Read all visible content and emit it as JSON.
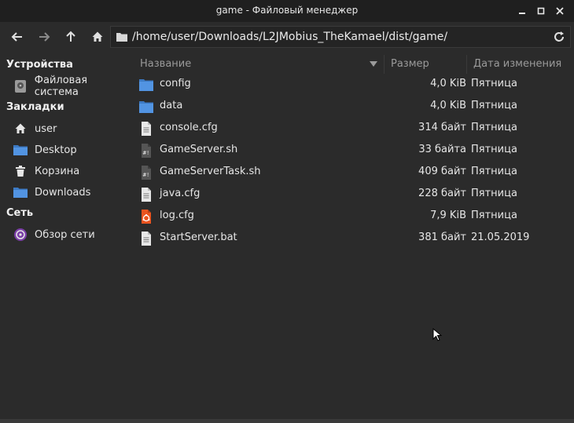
{
  "window": {
    "title": "game - Файловый менеджер"
  },
  "toolbar": {
    "back_icon": "arrow-left-icon",
    "forward_icon": "arrow-right-icon",
    "up_icon": "arrow-up-icon",
    "home_icon": "home-icon",
    "path": "/home/user/Downloads/L2JMobius_TheKamael/dist/game/",
    "reload_icon": "reload-icon"
  },
  "sidebar": {
    "devices_title": "Устройства",
    "devices": [
      {
        "label": "Файловая система",
        "icon": "drive-icon"
      }
    ],
    "bookmarks_title": "Закладки",
    "bookmarks": [
      {
        "label": "user",
        "icon": "home-icon"
      },
      {
        "label": "Desktop",
        "icon": "desktop-folder-icon"
      },
      {
        "label": "Корзина",
        "icon": "trash-icon"
      },
      {
        "label": "Downloads",
        "icon": "folder-icon"
      }
    ],
    "network_title": "Сеть",
    "network": [
      {
        "label": "Обзор сети",
        "icon": "network-icon"
      }
    ]
  },
  "columns": {
    "name": "Название",
    "size": "Размер",
    "date": "Дата изменения"
  },
  "files": [
    {
      "name": "config",
      "size": "4,0 KiB",
      "date": "Пятница",
      "icon": "folder-icon"
    },
    {
      "name": "data",
      "size": "4,0 KiB",
      "date": "Пятница",
      "icon": "folder-icon"
    },
    {
      "name": "console.cfg",
      "size": "314 байт",
      "date": "Пятница",
      "icon": "text-file-icon"
    },
    {
      "name": "GameServer.sh",
      "size": "33 байта",
      "date": "Пятница",
      "icon": "script-file-icon"
    },
    {
      "name": "GameServerTask.sh",
      "size": "409 байт",
      "date": "Пятница",
      "icon": "script-file-icon"
    },
    {
      "name": "java.cfg",
      "size": "228 байт",
      "date": "Пятница",
      "icon": "text-file-icon"
    },
    {
      "name": "log.cfg",
      "size": "7,9 KiB",
      "date": "Пятница",
      "icon": "ubuntu-file-icon"
    },
    {
      "name": "StartServer.bat",
      "size": "381 байт",
      "date": "21.05.2019",
      "icon": "text-file-icon"
    }
  ],
  "colors": {
    "background": "#2b2b2b",
    "titlebar": "#1f1f1f",
    "folder": "#5294e2",
    "accent_orange": "#e95420"
  }
}
